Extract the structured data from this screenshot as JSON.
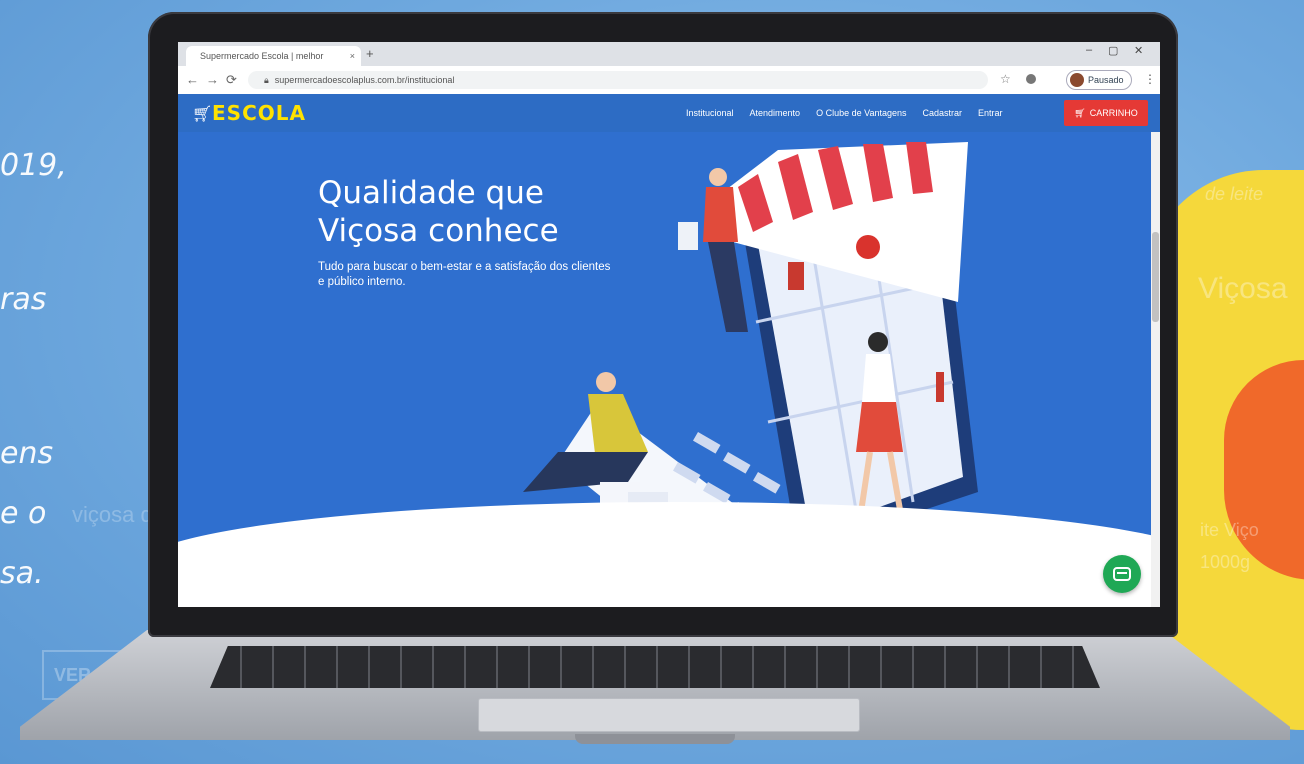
{
  "background": {
    "left_text": [
      "019,",
      "ras",
      "ens",
      "e o",
      "sa."
    ],
    "left_faint": "viçosa d",
    "right_faint": [
      "de leite",
      "Viçosa",
      "ite Viço",
      "1000g"
    ],
    "button_label": "VER"
  },
  "browser": {
    "tab_title": "Supermercado Escola | melhor",
    "tab_close": "×",
    "new_tab": "+",
    "url": "supermercadoescolaplus.com.br/institucional",
    "profile_label": "Pausado",
    "window_controls": [
      "–",
      "▢",
      "✕"
    ]
  },
  "site": {
    "logo": "ESCOLA",
    "nav": [
      "Institucional",
      "Atendimento",
      "O Clube de Vantagens",
      "Cadastrar",
      "Entrar"
    ],
    "cart_label": "CARRINHO",
    "hero_title": "Qualidade que Viçosa conhece",
    "hero_subtitle": "Tudo para buscar o bem-estar e a satisfação dos clientes e público interno."
  },
  "colors": {
    "header": "#2d6cc4",
    "hero": "#2f6fcf",
    "cart": "#e53935",
    "chat": "#1fa855",
    "logo": "#ffe200"
  }
}
